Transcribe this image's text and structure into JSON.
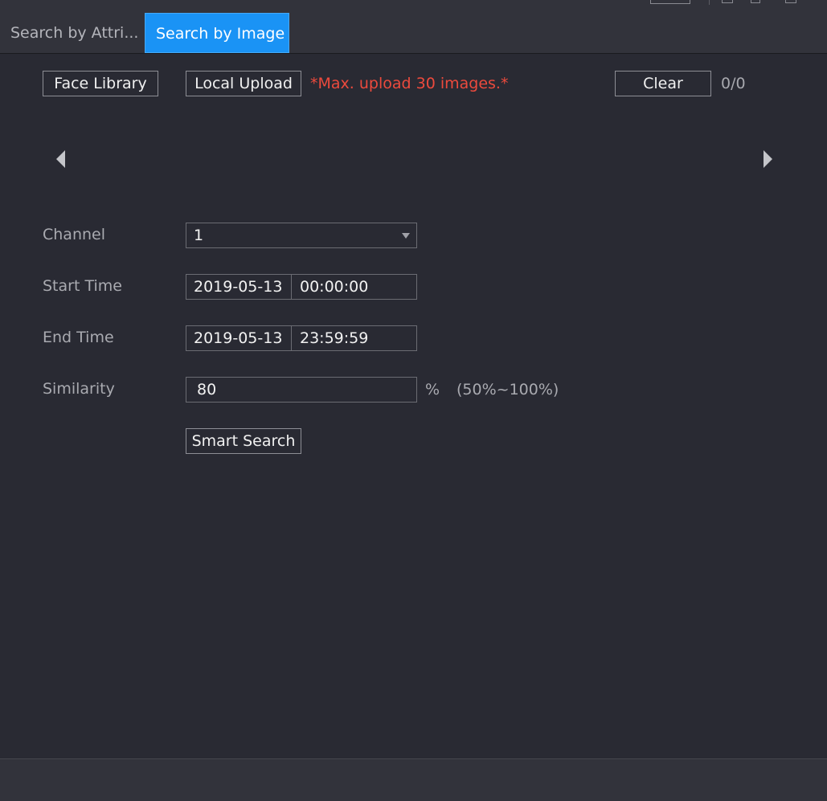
{
  "tabs": [
    {
      "label": "Search by Attri...",
      "active": false
    },
    {
      "label": "Search by Image",
      "active": true
    }
  ],
  "upload": {
    "face_library_label": "Face Library",
    "local_upload_label": "Local Upload",
    "hint": "*Max. upload 30 images.*",
    "clear_label": "Clear",
    "count": "0/0"
  },
  "form": {
    "channel": {
      "label": "Channel",
      "value": "1"
    },
    "start_time": {
      "label": "Start Time",
      "date": "2019-05-13",
      "time": "00:00:00"
    },
    "end_time": {
      "label": "End Time",
      "date": "2019-05-13",
      "time": "23:59:59"
    },
    "similarity": {
      "label": "Similarity",
      "value": "80",
      "unit": "%",
      "range": "(50%~100%)"
    },
    "smart_search_label": "Smart Search"
  },
  "colors": {
    "accent": "#1a93f5",
    "hint": "#ec4a3d",
    "background": "#292a33"
  },
  "icons": {
    "prev": "triangle-left-icon",
    "next": "triangle-right-icon",
    "dropdown": "caret-down-icon"
  }
}
